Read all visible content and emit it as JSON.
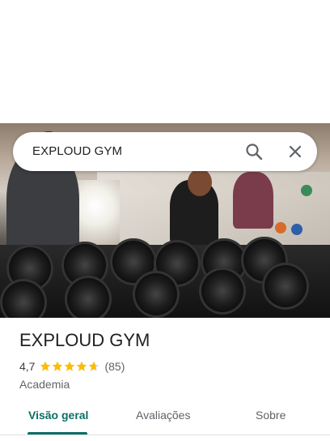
{
  "search": {
    "query": "EXPLOUD GYM"
  },
  "place": {
    "name": "EXPLOUD GYM",
    "rating": "4,7",
    "rating_stars": 4.7,
    "review_count": "(85)",
    "category": "Academia"
  },
  "tabs": [
    {
      "label": "Visão geral",
      "active": true
    },
    {
      "label": "Avaliações",
      "active": false
    },
    {
      "label": "Sobre",
      "active": false
    }
  ],
  "colors": {
    "accent": "#0b6e63",
    "star": "#fbbc04"
  },
  "icons": {
    "search": "search-icon",
    "close": "close-icon",
    "star": "star-icon"
  }
}
